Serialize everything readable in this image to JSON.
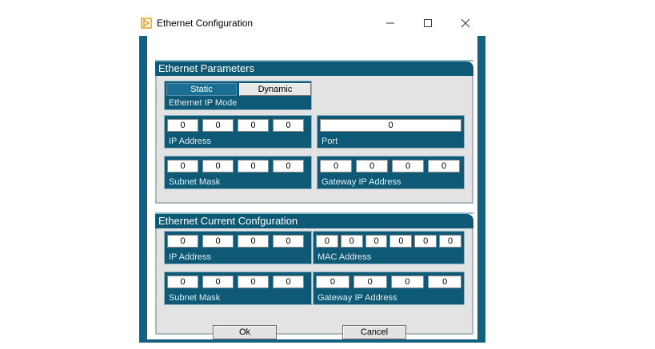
{
  "window": {
    "title": "Ethernet Configuration"
  },
  "params": {
    "header": "Ethernet Parameters",
    "mode": {
      "static_label": "Static",
      "dynamic_label": "Dynamic",
      "caption": "Ethernet IP Mode",
      "selected": "Static"
    },
    "ip": {
      "label": "IP Address",
      "values": [
        "0",
        "0",
        "0",
        "0"
      ]
    },
    "port": {
      "label": "Port",
      "value": "0"
    },
    "subnet": {
      "label": "Subnet Mask",
      "values": [
        "0",
        "0",
        "0",
        "0"
      ]
    },
    "gateway": {
      "label": "Gateway IP Address",
      "values": [
        "0",
        "0",
        "0",
        "0"
      ]
    }
  },
  "current": {
    "header": "Ethernet Current Confguration",
    "ip": {
      "label": "IP Address",
      "values": [
        "0",
        "0",
        "0",
        "0"
      ]
    },
    "mac": {
      "label": "MAC Address",
      "values": [
        "0",
        "0",
        "0",
        "0",
        "0",
        "0"
      ]
    },
    "subnet": {
      "label": "Subnet Mask",
      "values": [
        "0",
        "0",
        "0",
        "0"
      ]
    },
    "gateway": {
      "label": "Gateway IP Address",
      "values": [
        "0",
        "0",
        "0",
        "0"
      ]
    }
  },
  "buttons": {
    "ok": "Ok",
    "cancel": "Cancel"
  },
  "colors": {
    "frame": "#14627f",
    "panel": "#0e5a76",
    "selected_mode": "#1a6f94"
  }
}
